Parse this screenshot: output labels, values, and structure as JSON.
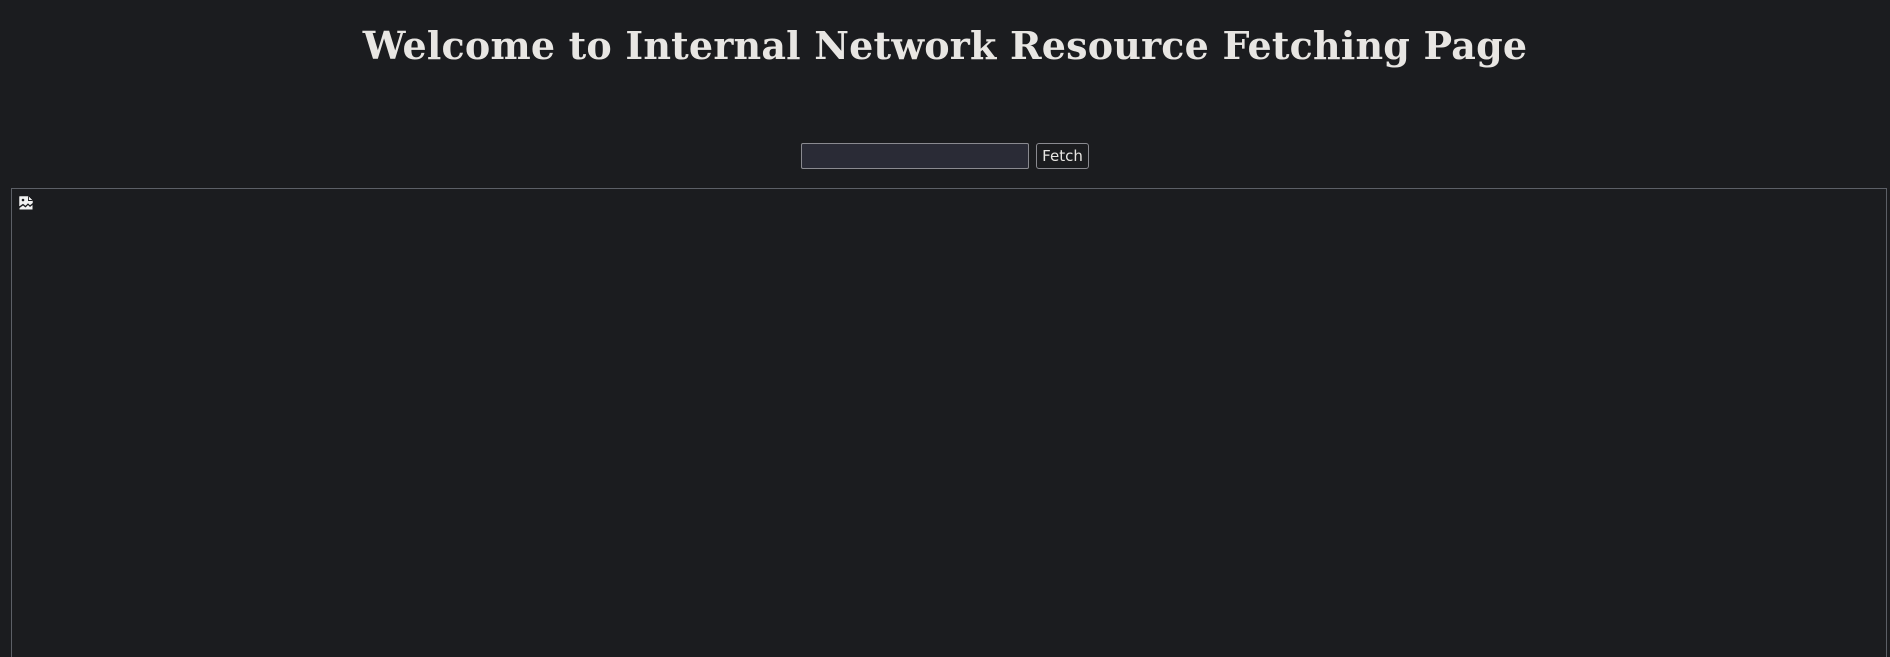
{
  "page": {
    "title": "Welcome to Internal Network Resource Fetching Page"
  },
  "form": {
    "input_value": "",
    "input_placeholder": "",
    "fetch_label": "Fetch"
  },
  "result": {
    "icon": "broken-image-icon"
  },
  "colors": {
    "background": "#1b1c1f",
    "text": "#e8e6e3",
    "input_background": "#2a2b36",
    "border": "#8a8a90",
    "frame_border": "#5c5f66"
  }
}
